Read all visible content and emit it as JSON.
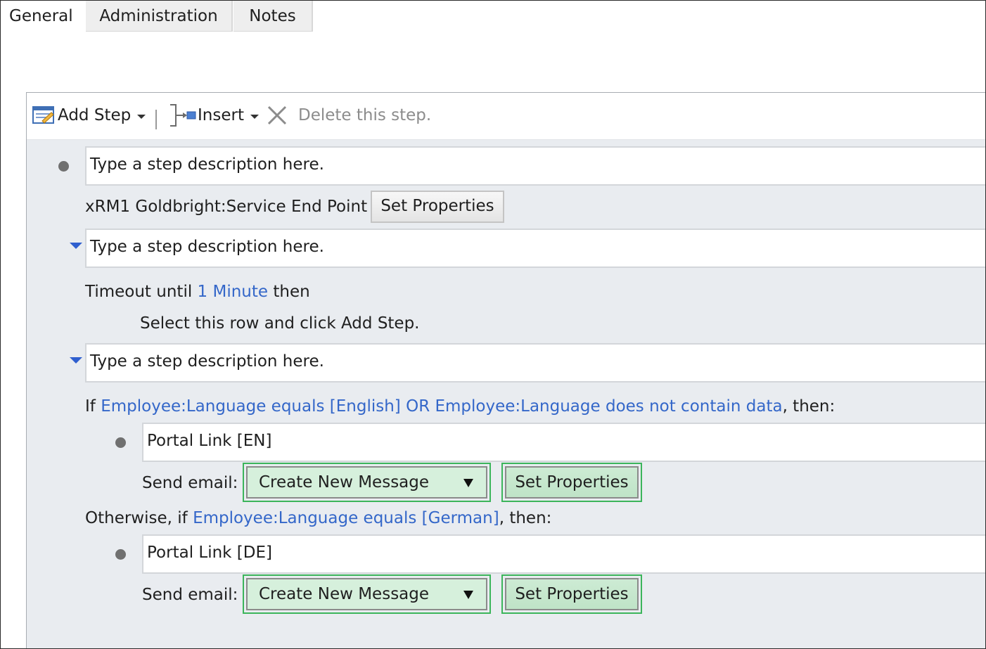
{
  "tabs": [
    {
      "label": "General"
    },
    {
      "label": "Administration"
    },
    {
      "label": "Notes"
    }
  ],
  "toolbar": {
    "add_step": "Add Step",
    "insert": "Insert",
    "delete": "Delete this step."
  },
  "steps": {
    "step1_desc": "Type a step description here.",
    "step1_action": "xRM1 Goldbright:Service End Point",
    "step1_button": "Set Properties",
    "step2_desc": "Type a step description here.",
    "timeout_prefix": "Timeout until",
    "timeout_value": "1 Minute",
    "timeout_suffix": "then",
    "timeout_hint": "Select this row and click Add Step.",
    "step3_desc": "Type a step description here.",
    "if_prefix": "If",
    "if_condition": "Employee:Language equals [English] OR Employee:Language does not contain data",
    "if_suffix": ", then:",
    "branch1_desc": "Portal Link [EN]",
    "branch1_label": "Send email:",
    "branch1_select": "Create New Message",
    "branch1_button": "Set Properties",
    "else_prefix": "Otherwise, if",
    "else_condition": "Employee:Language equals [German]",
    "else_suffix": ", then:",
    "branch2_desc": "Portal Link [DE]",
    "branch2_label": "Send email:",
    "branch2_select": "Create New Message",
    "branch2_button": "Set Properties"
  },
  "colors": {
    "link": "#3467c9",
    "highlight_border": "#3cb55b",
    "highlight_fill": "#d6f0dc",
    "panel_bg": "#e9ecf0"
  }
}
